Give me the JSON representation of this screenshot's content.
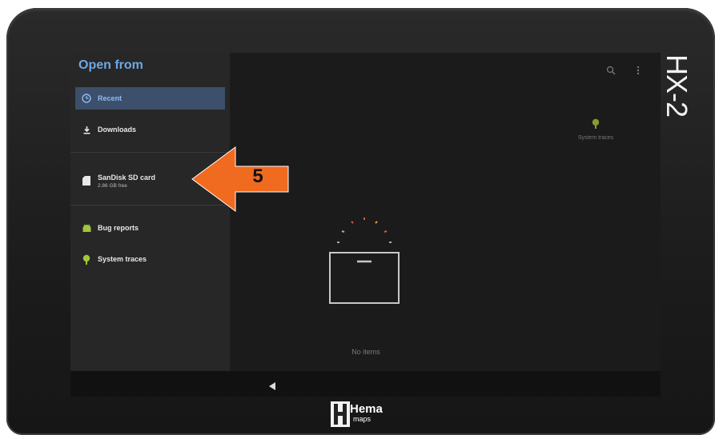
{
  "drawer": {
    "title": "Open from",
    "items": [
      {
        "label": "Recent",
        "icon": "clock-icon",
        "selected": true
      },
      {
        "label": "Downloads",
        "icon": "download-icon"
      },
      {
        "label": "SanDisk SD card",
        "sub": "2.86 GB free",
        "icon": "sd-card-icon"
      },
      {
        "label": "Bug reports",
        "icon": "android-icon"
      },
      {
        "label": "System traces",
        "icon": "android-icon"
      }
    ]
  },
  "content": {
    "folder_label": "System traces",
    "empty_text": "No items"
  },
  "callout": {
    "number": "5",
    "color": "#f06a1f"
  },
  "device": {
    "model": "HX-2"
  },
  "brand": {
    "name": "Hema",
    "sub": "maps"
  },
  "colors": {
    "accent": "#6da7e6",
    "android_green": "#a4c639"
  }
}
